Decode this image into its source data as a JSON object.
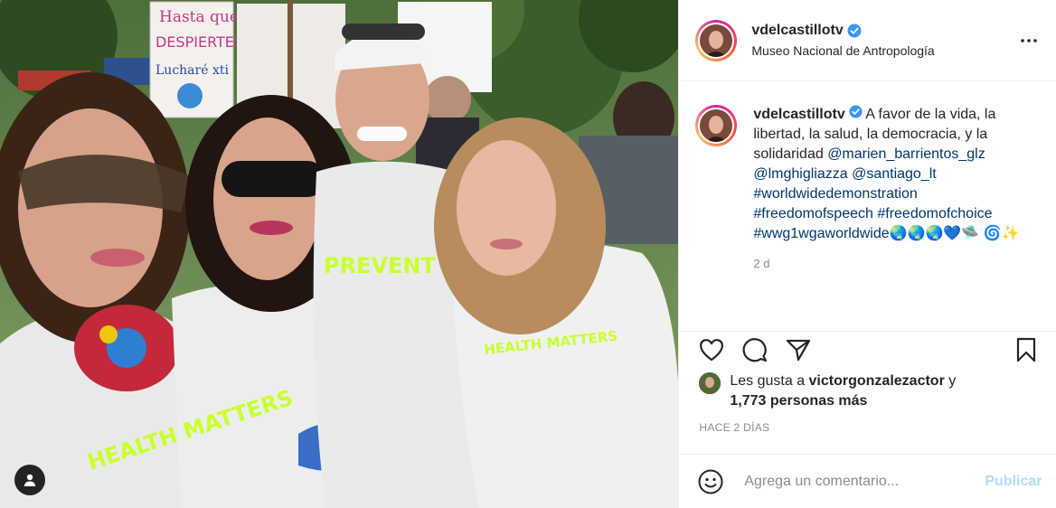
{
  "post": {
    "username": "vdelcastillotv",
    "location": "Museo Nacional de Antropología",
    "caption": {
      "username": "vdelcastillotv",
      "text_line1": " A favor de la vida, la libertad, la salud, la democracia, y la solidaridad ",
      "mention1": "@marien_barrientos_glz",
      "mention2": "@lmghigliazza",
      "mention3": "@santiago_lt",
      "hashtag1": "#worldwidedemonstration",
      "hashtag2": "#freedomofspeech",
      "hashtag3": "#freedomofchoice",
      "hashtag4": "#wwg1wgaworldwide",
      "emojis1": "🌏🌏🌏💙🛸",
      "emojis2": "🌀✨"
    },
    "caption_age": "2 d",
    "likes_prefix": "Les gusta a ",
    "likes_user": "victorgonzalezactor",
    "likes_conj": " y",
    "likes_count": "1,773 personas más",
    "timestamp": "HACE 2 DÍAS",
    "comment_placeholder": "Agrega un comentario...",
    "publish_label": "Publicar"
  },
  "photo": {
    "sign_text_1": "Hasta que",
    "sign_text_2": "DESPIERTES",
    "sign_text_3": "Lucharé xti",
    "shirt_text_1": "PREVENT",
    "shirt_text_2": "HEALTH MATTERS",
    "shirt_text_3": "HEALTH MATTERS"
  },
  "colors": {
    "link": "#00376b",
    "verified": "#3897f0",
    "publish_disabled": "#b3dbff",
    "neon": "#c8ff2e"
  },
  "icons": {
    "more": "more-options-icon",
    "heart": "heart-icon",
    "comment": "comment-icon",
    "share": "share-icon",
    "save": "bookmark-icon",
    "emoji": "emoji-icon",
    "user_tag": "user-tag-icon",
    "verified": "verified-badge-icon"
  }
}
